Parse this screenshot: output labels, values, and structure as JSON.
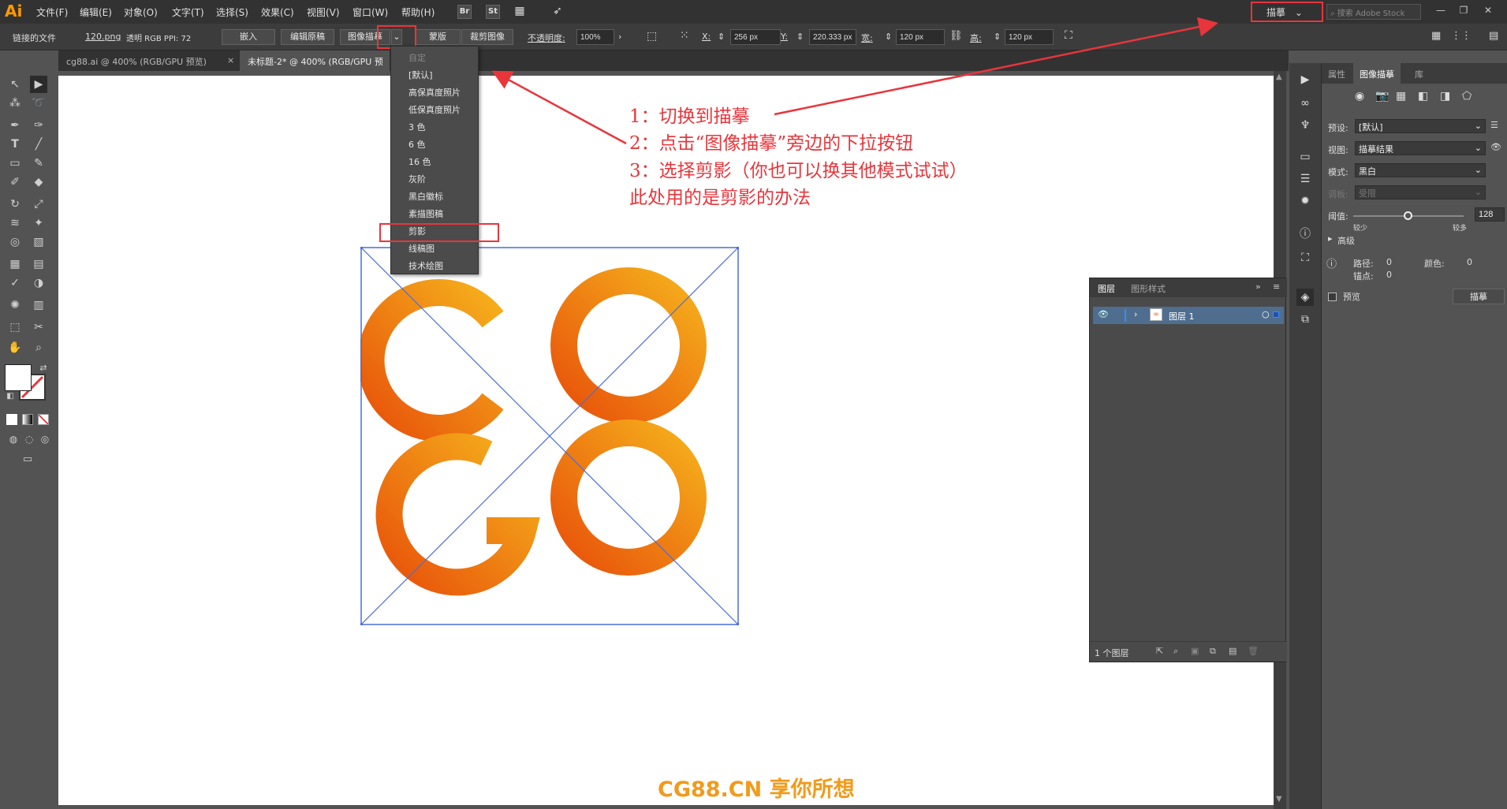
{
  "menubar": {
    "logo": "Ai",
    "items": [
      "文件(F)",
      "编辑(E)",
      "对象(O)",
      "文字(T)",
      "选择(S)",
      "效果(C)",
      "视图(V)",
      "窗口(W)",
      "帮助(H)"
    ],
    "bridge": "Br",
    "stock": "St",
    "workspace": "描摹",
    "search_placeholder": "搜索 Adobe Stock"
  },
  "controlbar": {
    "linked_file": "链接的文件",
    "filename": "120.png",
    "color_info": "透明 RGB PPI: 72",
    "embed": "嵌入",
    "edit_original": "编辑原稿",
    "image_trace": "图像描摹",
    "mask": "蒙版",
    "crop": "裁剪图像",
    "opacity_label": "不透明度:",
    "opacity_value": "100%",
    "x_label": "X:",
    "x_value": "256 px",
    "y_label": "Y:",
    "y_value": "220.333 px",
    "w_label": "宽:",
    "w_value": "120 px",
    "h_label": "高:",
    "h_value": "120 px"
  },
  "tabs": [
    {
      "label": "cg88.ai @ 400% (RGB/GPU 预览)",
      "close": "×"
    },
    {
      "label": "未标题-2* @ 400% (RGB/GPU 预"
    }
  ],
  "dropdown": {
    "items": [
      "自定",
      "[默认]",
      "高保真度照片",
      "低保真度照片",
      "3 色",
      "6 色",
      "16 色",
      "灰阶",
      "黑白徽标",
      "素描图稿",
      "剪影",
      "线稿图",
      "技术绘图"
    ],
    "selected": "剪影"
  },
  "annotations": {
    "step1": "1：切换到描摹",
    "step2": "2：点击“图像描摹”旁边的下拉按钮",
    "step3": "3：选择剪影（你也可以换其他模式试试）",
    "note": "此处用的是剪影的办法"
  },
  "brand": "CG88.CN 享你所想",
  "trace_panel": {
    "tabs": [
      "属性",
      "图像描摹",
      "库"
    ],
    "preset_label": "预设:",
    "preset_value": "[默认]",
    "view_label": "视图:",
    "view_value": "描摹结果",
    "mode_label": "模式:",
    "mode_value": "黑白",
    "palette_label": "调板:",
    "palette_value": "受限",
    "threshold_label": "阈值:",
    "threshold_value": "128",
    "threshold_fraction": 0.5,
    "less": "较少",
    "more": "较多",
    "advanced": "高级",
    "paths_label": "路径:",
    "paths_value": "0",
    "colors_label": "颜色:",
    "colors_value": "0",
    "anchors_label": "锚点:",
    "anchors_value": "0",
    "preview": "预览",
    "trace_button": "描摹"
  },
  "layers_panel": {
    "tabs": [
      "图层",
      "图形样式"
    ],
    "layer_name": "图层 1",
    "count": "1 个图层"
  },
  "colors": {
    "accent_red": "#e8353b",
    "layer_highlight": "#4f6d8f",
    "brand_orange": "#f29a1a",
    "logo_dark": "#e8520a",
    "logo_light": "#f5b01c"
  }
}
